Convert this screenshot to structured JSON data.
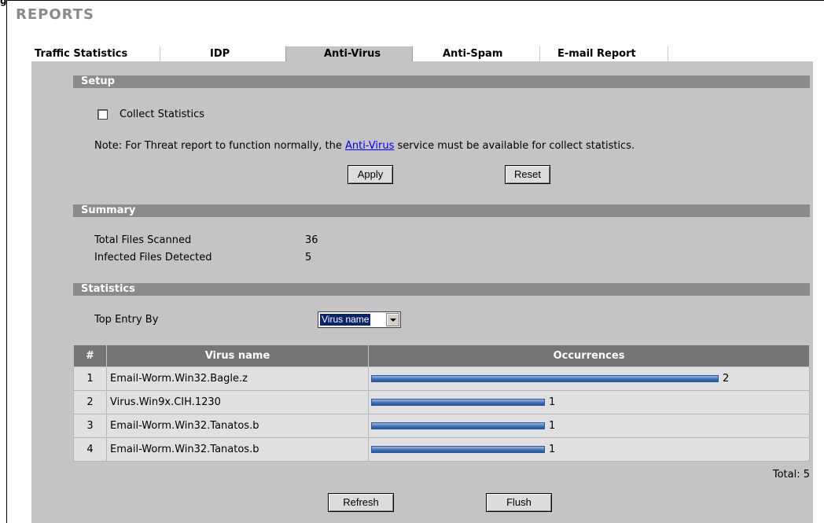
{
  "figure_label": "g",
  "page_title": "REPORTS",
  "tabs": [
    {
      "label": "Traffic Statistics"
    },
    {
      "label": "IDP"
    },
    {
      "label": "Anti-Virus",
      "active": true
    },
    {
      "label": "Anti-Spam"
    },
    {
      "label": "E-mail Report"
    }
  ],
  "setup": {
    "title": "Setup",
    "collect_label": "Collect Statistics",
    "collect_checked": false,
    "note_before": "Note: For Threat report to function normally, the",
    "note_link": "Anti-Virus",
    "note_after": "service must be available for collect statistics.",
    "apply_label": "Apply",
    "reset_label": "Reset"
  },
  "summary": {
    "title": "Summary",
    "total_label": "Total Files Scanned",
    "total_value": "36",
    "infected_label": "Infected Files Detected",
    "infected_value": "5"
  },
  "statistics": {
    "title": "Statistics",
    "top_entry_label": "Top Entry By",
    "top_entry_value": "Virus name",
    "columns": [
      "#",
      "Virus name",
      "Occurrences"
    ],
    "rows": [
      {
        "num": "1",
        "name": "Email-Worm.Win32.Bagle.z",
        "occurrences": 2
      },
      {
        "num": "2",
        "name": "Virus.Win9x.CIH.1230",
        "occurrences": 1
      },
      {
        "num": "3",
        "name": "Email-Worm.Win32.Tanatos.b",
        "occurrences": 1
      },
      {
        "num": "4",
        "name": "Email-Worm.Win32.Tanatos.b",
        "occurrences": 1
      }
    ],
    "total_text": "Total: 5",
    "refresh_label": "Refresh",
    "flush_label": "Flush"
  },
  "colors": {
    "panel": "#c6c3c6",
    "section_bar": "#8b8b8b",
    "table_header": "#757575",
    "bar": "#3d6fb3"
  }
}
